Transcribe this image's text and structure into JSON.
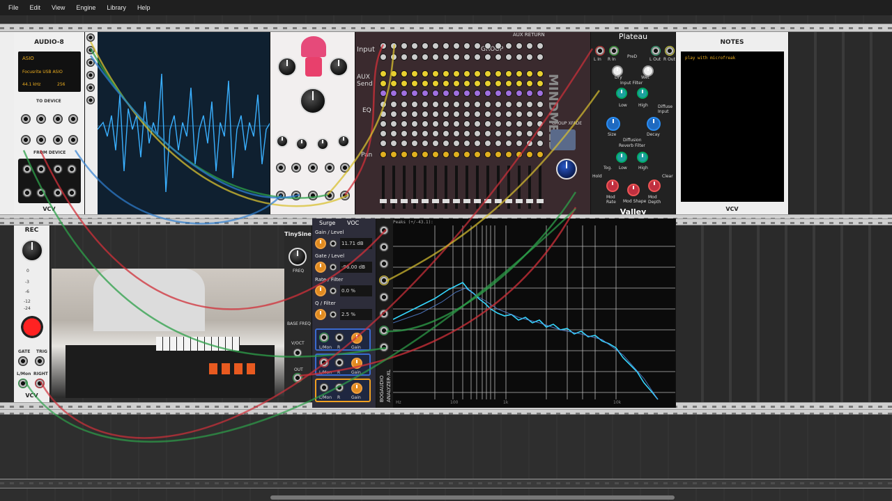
{
  "menu": [
    "File",
    "Edit",
    "View",
    "Engine",
    "Library",
    "Help"
  ],
  "audio8": {
    "title": "AUDIO-8",
    "driver": "ASIO",
    "device": "Focusrite USB ASIO",
    "rate": "44.1 kHz",
    "buffer": "256",
    "to_device": "TO DEVICE",
    "from_device": "FROM DEVICE",
    "brand": "VCV"
  },
  "group_module": {
    "input_label": "Input",
    "aux_send_label": "AUX Send",
    "eq_label": "EQ",
    "pan_label": "Pan",
    "group_label": "GROUP",
    "aux_return_label": "AUX RETURN",
    "group_xfade": "GROUP XFADE",
    "vertical_brand": "MINDMELD"
  },
  "plateau": {
    "title": "Plateau",
    "brand": "Valley",
    "labels": [
      "L In",
      "R In",
      "PreD",
      "L Out",
      "R Out",
      "Dry",
      "Wet",
      "Input Filter",
      "Low",
      "High",
      "Diffuse Input",
      "Size",
      "Decay",
      "Diffusion",
      "Reverb Filter",
      "Low",
      "High",
      "Hold",
      "Clear",
      "Tog.",
      "Mod Rate",
      "Mod Shape",
      "Mod Depth"
    ]
  },
  "notes": {
    "title": "NOTES",
    "text": "play with microfreak",
    "brand": "VCV"
  },
  "rec": {
    "title": "REC",
    "gate": "GATE",
    "trig": "TRIG",
    "left": "L/Mon",
    "right": "RIGHT",
    "brand": "VCV",
    "levels": [
      "0",
      "-3",
      "-6",
      "-12",
      "-24"
    ]
  },
  "tinysine": {
    "title": "TinySine",
    "freq": "FREQ",
    "base_freq": "BASE FREQ",
    "voct": "V/OCT",
    "out": "OUT"
  },
  "surge": {
    "title": "Surge",
    "vco": "VOC",
    "gain_label": "Gain / Level",
    "gain_value": "11.71 dB",
    "gate_label": "Gate / Level",
    "gate_value": "-96.00 dB",
    "rate_label": "Rate / Filter",
    "rate_value": "0.0 %",
    "q_label": "Q / Filter",
    "q_value": "2.5 %",
    "lmon": "L/Mon",
    "r": "R",
    "gain": "Gain"
  },
  "analyzer": {
    "header": "Peaks (+/-43.1):",
    "brand_line1": "ANALYZER-XL",
    "brand_line2": "BOGAUDIO",
    "x_ticks": [
      "Hz",
      "100",
      "1k",
      "10k"
    ]
  },
  "colors": {
    "scope_trace": "#3ab0ff",
    "analyzer_trace": "#35d8ff",
    "cable_red": "#d0303a",
    "cable_green": "#2ea04a",
    "cable_yellow": "#d8c030",
    "cable_blue": "#2f7fd0",
    "orange_knob": "#e08a20"
  }
}
